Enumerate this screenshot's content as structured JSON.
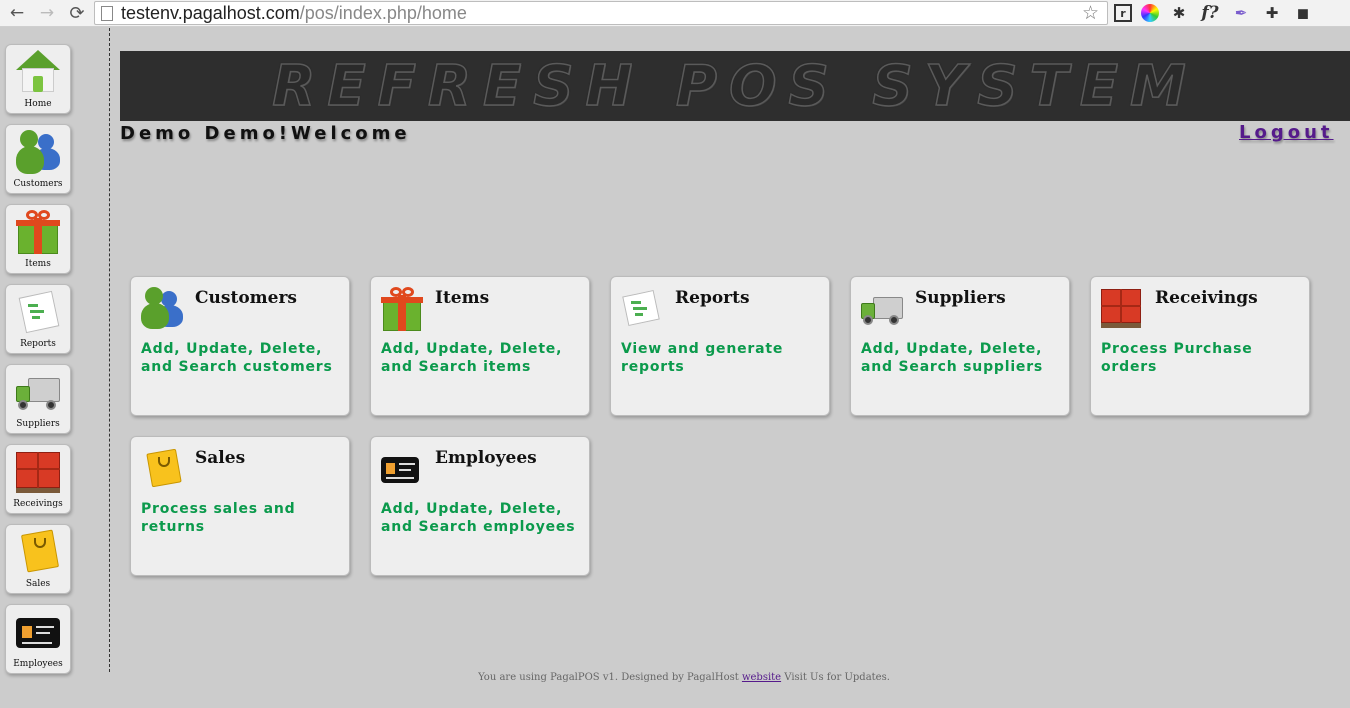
{
  "browser": {
    "url_host": "testenv.pagalhost.com",
    "url_path": "/pos/index.php/home",
    "back_icon": "←",
    "forward_icon": "→",
    "reload_icon": "⟳",
    "star_icon": "☆",
    "ext_icons": [
      "box-icon",
      "color-wheel-icon",
      "bug-icon",
      "fquery-icon",
      "feather-icon",
      "puzzle-icon",
      "evernote-icon"
    ],
    "ext_glyphs": [
      "r",
      "",
      "✱",
      "f?",
      "✒",
      "✚",
      "◼"
    ]
  },
  "sidebar": {
    "items": [
      {
        "label": "Home",
        "icon": "house-icon"
      },
      {
        "label": "Customers",
        "icon": "people-icon"
      },
      {
        "label": "Items",
        "icon": "gift-icon"
      },
      {
        "label": "Reports",
        "icon": "report-icon"
      },
      {
        "label": "Suppliers",
        "icon": "truck-icon"
      },
      {
        "label": "Receivings",
        "icon": "crates-icon"
      },
      {
        "label": "Sales",
        "icon": "shopping-bag-icon"
      },
      {
        "label": "Employees",
        "icon": "id-card-icon"
      }
    ]
  },
  "header": {
    "title": "REFRESH POS SYSTEM",
    "welcome": "Demo Demo!Welcome",
    "logout": "Logout"
  },
  "modules": [
    {
      "title": "Customers",
      "desc": "Add, Update, Delete, and Search customers",
      "icon": "people-icon"
    },
    {
      "title": "Items",
      "desc": "Add, Update, Delete, and Search items",
      "icon": "gift-icon"
    },
    {
      "title": "Reports",
      "desc": "View and generate reports",
      "icon": "report-icon"
    },
    {
      "title": "Suppliers",
      "desc": "Add, Update, Delete, and Search suppliers",
      "icon": "truck-icon"
    },
    {
      "title": "Receivings",
      "desc": "Process Purchase orders",
      "icon": "crates-icon"
    },
    {
      "title": "Sales",
      "desc": "Process sales and returns",
      "icon": "shopping-bag-icon"
    },
    {
      "title": "Employees",
      "desc": "Add, Update, Delete, and Search employees",
      "icon": "id-card-icon"
    }
  ],
  "footer": {
    "before": "You are using PagalPOS v1. Designed by PagalHost",
    "link": "website",
    "after": "Visit Us for Updates."
  },
  "colors": {
    "background": "#cccccc",
    "banner": "#2e2e2e",
    "accent_green": "#0b9a4c",
    "link_purple": "#551a8b"
  }
}
